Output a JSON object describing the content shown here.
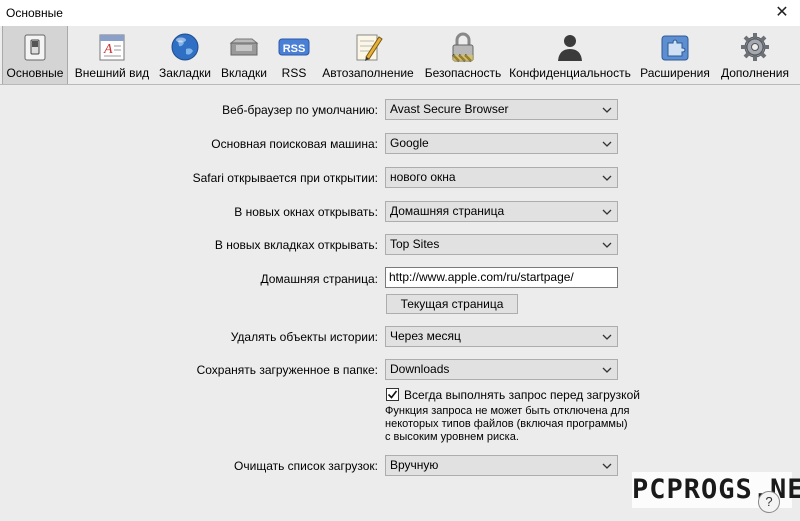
{
  "window": {
    "title": "Основные"
  },
  "toolbar": {
    "items": [
      {
        "label": "Основные",
        "icon": "general-switch-icon",
        "active": true
      },
      {
        "label": "Внешний вид",
        "icon": "appearance-icon"
      },
      {
        "label": "Закладки",
        "icon": "globe-icon"
      },
      {
        "label": "Вкладки",
        "icon": "tabs-icon"
      },
      {
        "label": "RSS",
        "icon": "rss-icon",
        "icon_text": "RSS"
      },
      {
        "label": "Автозаполнение",
        "icon": "autofill-pencil-icon"
      },
      {
        "label": "Безопасность",
        "icon": "lock-icon"
      },
      {
        "label": "Конфиденциальность",
        "icon": "privacy-silhouette-icon"
      },
      {
        "label": "Расширения",
        "icon": "extensions-puzzle-icon"
      },
      {
        "label": "Дополнения",
        "icon": "gear-icon"
      }
    ]
  },
  "general": {
    "default_browser": {
      "label": "Веб-браузер по умолчанию:",
      "value": "Avast Secure Browser"
    },
    "search_engine": {
      "label": "Основная поисковая машина:",
      "value": "Google"
    },
    "safari_opens": {
      "label": "Safari открывается при открытии:",
      "value": "нового окна"
    },
    "new_windows": {
      "label": "В новых окнах открывать:",
      "value": "Домашняя страница"
    },
    "new_tabs": {
      "label": "В новых вкладках открывать:",
      "value": "Top Sites"
    },
    "homepage": {
      "label": "Домашняя страница:",
      "value": "http://www.apple.com/ru/startpage/",
      "button": "Текущая страница"
    },
    "remove_history": {
      "label": "Удалять объекты истории:",
      "value": "Через месяц"
    },
    "save_downloads": {
      "label": "Сохранять загруженное в папке:",
      "value": "Downloads"
    },
    "ask_before_download": {
      "label": "Всегда выполнять запрос перед загрузкой",
      "checked": true,
      "note": "Функция запроса не может быть отключена для некоторых типов файлов (включая программы) с высоким уровнем риска."
    },
    "clear_downloads": {
      "label": "Очищать список загрузок:",
      "value": "Вручную"
    }
  },
  "watermark": "PCPROGS.NET",
  "help_label": "?"
}
